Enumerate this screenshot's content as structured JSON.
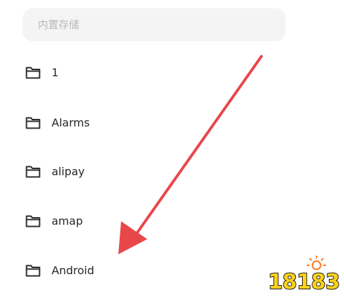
{
  "search": {
    "placeholder": "内置存储",
    "value": ""
  },
  "folders": [
    {
      "name": "1",
      "icon": "folder-icon"
    },
    {
      "name": "Alarms",
      "icon": "folder-icon"
    },
    {
      "name": "alipay",
      "icon": "folder-icon"
    },
    {
      "name": "amap",
      "icon": "folder-icon"
    },
    {
      "name": "Android",
      "icon": "folder-icon"
    }
  ],
  "annotation": {
    "arrow_color": "#e8474a",
    "icon": "arrow-pointing-down-left"
  },
  "watermark": {
    "text": "18183",
    "icon": "site-logo",
    "colors": {
      "fill": "#ffd21a",
      "outline": "#1a1a1a",
      "accent": "#ff7a1a"
    }
  }
}
